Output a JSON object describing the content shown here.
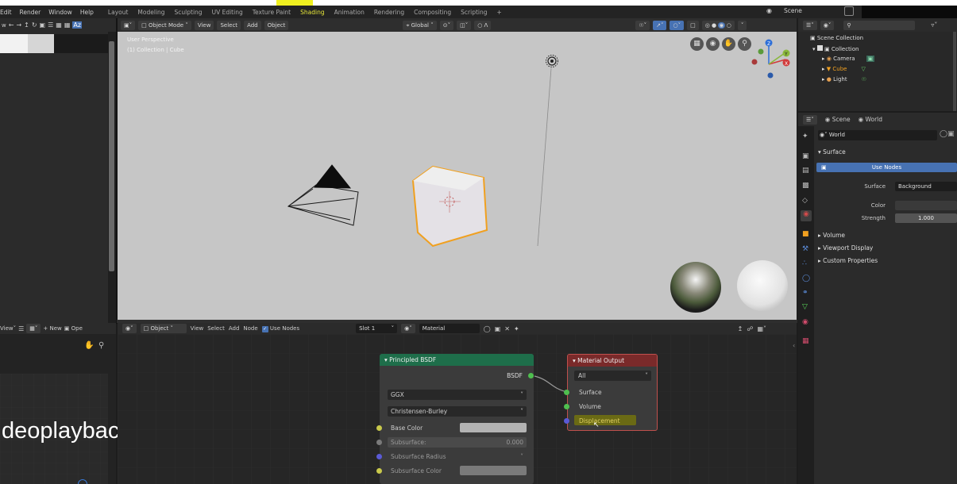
{
  "menu": {
    "items": [
      "Edit",
      "Render",
      "Window",
      "Help"
    ]
  },
  "workspaces": [
    "Layout",
    "Modeling",
    "Sculpting",
    "UV Editing",
    "Texture Paint",
    "Shading",
    "Animation",
    "Rendering",
    "Compositing",
    "Scripting",
    "+"
  ],
  "active_workspace": "Shading",
  "top_right": {
    "scene_label": "Scene"
  },
  "viewport": {
    "header": {
      "mode": "Object Mode",
      "menus": [
        "View",
        "Select",
        "Add",
        "Object"
      ],
      "orientation": "Global"
    },
    "overlay_line1": "User Perspective",
    "overlay_line2": "(1) Collection | Cube"
  },
  "outliner": {
    "root": "Scene Collection",
    "collection": "Collection",
    "items": [
      {
        "name": "Camera",
        "icon": "camera-icon"
      },
      {
        "name": "Cube",
        "icon": "mesh-icon"
      },
      {
        "name": "Light",
        "icon": "light-icon"
      }
    ]
  },
  "properties": {
    "tabs": [
      "Scene",
      "World"
    ],
    "world_name": "World",
    "section_surface": "Surface",
    "use_nodes": "Use Nodes",
    "rows": [
      {
        "label": "Surface",
        "value": "Background"
      },
      {
        "label": "Color",
        "value": ""
      },
      {
        "label": "Strength",
        "value": "1.000"
      }
    ],
    "collapsed": [
      "Volume",
      "Viewport Display",
      "Custom Properties"
    ]
  },
  "file_browser": {
    "view_label": "View",
    "new_label": "New",
    "open_label": "Ope"
  },
  "node_editor": {
    "header": {
      "object_label": "Object",
      "menus": [
        "View",
        "Select",
        "Add",
        "Node"
      ],
      "use_nodes": "Use Nodes",
      "slot": "Slot 1",
      "material": "Material"
    },
    "bsdf_node": {
      "title": "Principled BSDF",
      "output": "BSDF",
      "dist": "GGX",
      "sss": "Christensen-Burley",
      "inputs": [
        {
          "label": "Base Color",
          "value": ""
        },
        {
          "label": "Subsurface:",
          "value": "0.000"
        },
        {
          "label": "Subsurface Radius",
          "value": ""
        },
        {
          "label": "Subsurface Color",
          "value": ""
        }
      ]
    },
    "output_node": {
      "title": "Material Output",
      "target": "All",
      "inputs": [
        "Surface",
        "Volume",
        "Displacement"
      ]
    }
  },
  "overlay_caption": "deoplayback",
  "colors": {
    "accent": "#4772b3",
    "selection": "#f0a020",
    "bsdf_header": "#1e6e4a",
    "output_header": "#7a2a2a",
    "workspace_highlight": "#e6e63a"
  }
}
